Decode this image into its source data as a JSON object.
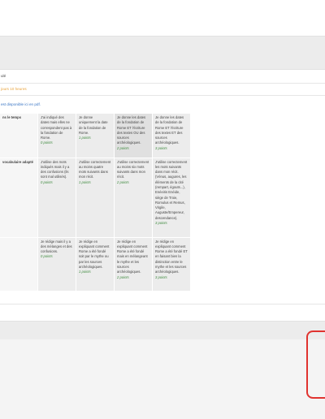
{
  "row_label": "ulé",
  "warning_text": "jours 10 heures",
  "link_text": "est disponible ici en pdf.",
  "rubric": [
    {
      "criterion": "ns le temps",
      "levels": [
        {
          "text": "J'ai indiqué des dates mais elles ne correspondent pas à la fondation de Rome.",
          "points": "0 points"
        },
        {
          "text": "Je donne uniquement la date de la fondation de Rome.",
          "points": "1 points"
        },
        {
          "text": "Je donne les dates de la fondation de Rome ET l'écriture des textes OU des sources archéologiques.",
          "points": "2 points"
        },
        {
          "text": "Je donne les dates de la fondation de Rome ET l'écriture des textes ET des sources archéologiques.",
          "points": "3 points"
        }
      ]
    },
    {
      "criterion": "vocabulaire adapté",
      "levels": [
        {
          "text": "J'utilise des mots indiqués mais il y a des confusions (ils sont mal utilisés).",
          "points": "0 points"
        },
        {
          "text": "J'utilise correctement au moins quatre mots suivants dans mon récit.",
          "points": "1 points"
        },
        {
          "text": "J'utilise correctement au moins six mots suivants dans mon récit.",
          "points": "2 points"
        },
        {
          "text": "J'utilise correctement les mots suivants dans mon récit. (Vénus, augures, les éléments de la cité (rempart, égouts...), Enéeiris Enéide, siège de Troie, Romulus et Remus, Virgile, Auguste/Empereur, descendance).",
          "points": "3 points"
        }
      ]
    },
    {
      "criterion": "",
      "levels": [
        {
          "text": "Je rédige mais il y a des mélanges et des confusions.",
          "points": "0 points"
        },
        {
          "text": "Je rédige en expliquant comment Rome a été fondé soit par le mythe ou par les sources archéologiques.",
          "points": "1 points"
        },
        {
          "text": "Je rédige en expliquant comment Rome a été fondé mais en mélangeant le mythe et les sources archéologiques.",
          "points": "2 points"
        },
        {
          "text": "Je rédige en expliquant comment Rome a été fondé ET en faisant bien la distinction entre le mythe et les sources archéologiques.",
          "points": "3 points"
        }
      ]
    }
  ]
}
